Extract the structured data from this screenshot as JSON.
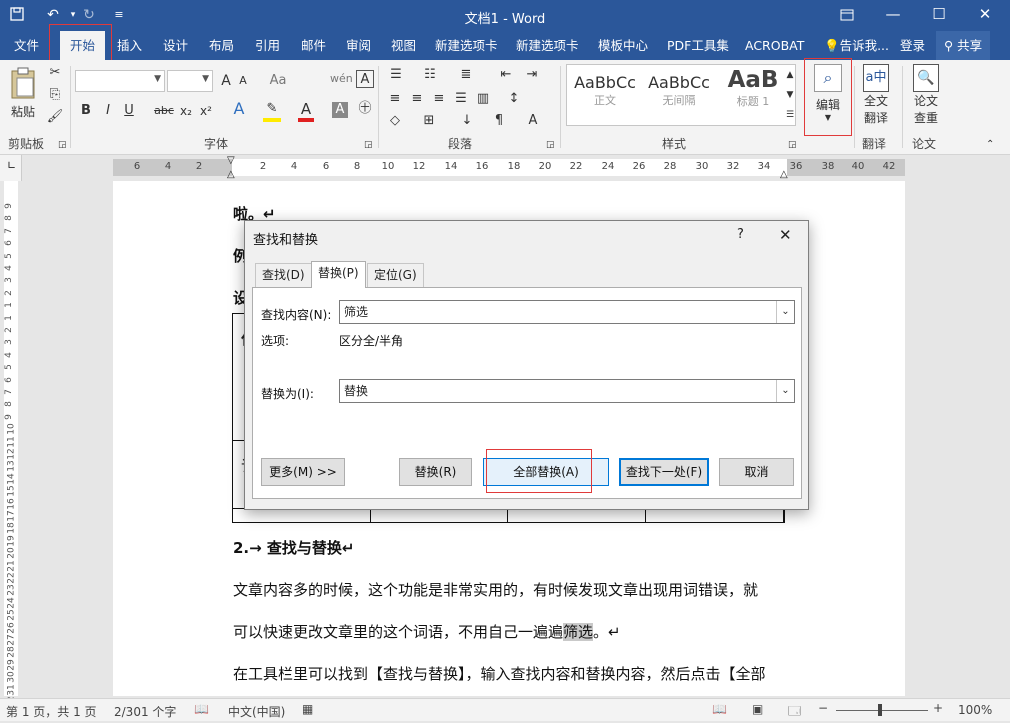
{
  "window": {
    "title": "文档1 - Word"
  },
  "tabs": [
    "文件",
    "开始",
    "插入",
    "设计",
    "布局",
    "引用",
    "邮件",
    "审阅",
    "视图",
    "新建选项卡",
    "新建选项卡",
    "模板中心",
    "PDF工具集",
    "ACROBAT"
  ],
  "tellme": "告诉我...",
  "login": "登录",
  "share": "共享",
  "ribbon": {
    "clipboard": {
      "paste": "粘贴",
      "group": "剪贴板"
    },
    "font": {
      "group": "字体",
      "grow": "A",
      "shrink": "A",
      "aa": "Aa",
      "bold": "B",
      "italic": "I",
      "underline": "U",
      "strike": "abc",
      "sub": "x₂",
      "sup": "x²"
    },
    "paragraph": {
      "group": "段落"
    },
    "styles": {
      "group": "样式",
      "items": [
        {
          "sample": "AaBbCc",
          "name": "正文"
        },
        {
          "sample": "AaBbCc",
          "name": "无间隔"
        },
        {
          "sample": "AaB",
          "name": "标题 1"
        }
      ]
    },
    "edit": {
      "label": "编辑"
    },
    "translate": {
      "label1": "全文",
      "label2": "翻译",
      "group": "翻译"
    },
    "paper": {
      "label1": "论文",
      "label2": "查重",
      "group": "论文"
    }
  },
  "ruler": {
    "ticks": [
      "6",
      "4",
      "2",
      "2",
      "4",
      "6",
      "8",
      "10",
      "12",
      "14",
      "16",
      "18",
      "20",
      "22",
      "24",
      "26",
      "28",
      "30",
      "32",
      "34",
      "36",
      "38",
      "40",
      "42"
    ]
  },
  "vruler": {
    "ticks": [
      "9",
      "8",
      "7",
      "6",
      "5",
      "4",
      "3",
      "2",
      "1",
      "1",
      "2",
      "3",
      "4",
      "5",
      "6",
      "7",
      "8",
      "9",
      "10",
      "11",
      "12",
      "13",
      "14",
      "15",
      "16",
      "17",
      "18",
      "19",
      "20",
      "21",
      "22",
      "23",
      "24",
      "25",
      "26",
      "27",
      "28",
      "29",
      "30",
      "31",
      "32"
    ]
  },
  "document": {
    "line1": "啦。↵",
    "frag1": "例",
    "frag2": "设",
    "frag3": "作",
    "frag4": "订",
    "heading": "2.→ 查找与替换↵",
    "para1": "文章内容多的时候，这个功能是非常实用的，有时候发现文章出现用词错误，就",
    "para2a": "可以快速更改文章里的这个词语，不用自己一遍遍",
    "para2hl": "筛选",
    "para2b": "。↵",
    "para3": "在工具栏里可以找到【查找与替换】，输入查找内容和替换内容，然后点击【全部"
  },
  "dialog": {
    "title": "查找和替换",
    "help": "?",
    "close": "✕",
    "tabs": [
      "查找(D)",
      "替换(P)",
      "定位(G)"
    ],
    "find_label": "查找内容(N):",
    "find_value": "筛选",
    "options_label": "选项:",
    "options_value": "区分全/半角",
    "replace_label": "替换为(I):",
    "replace_value": "替换",
    "buttons": {
      "more": "更多(M) >>",
      "replace": "替换(R)",
      "replace_all": "全部替换(A)",
      "find_next": "查找下一处(F)",
      "cancel": "取消"
    }
  },
  "status": {
    "page": "第 1 页，共 1 页",
    "words": "2/301 个字",
    "lang": "中文(中国)",
    "zoom": "100%"
  }
}
